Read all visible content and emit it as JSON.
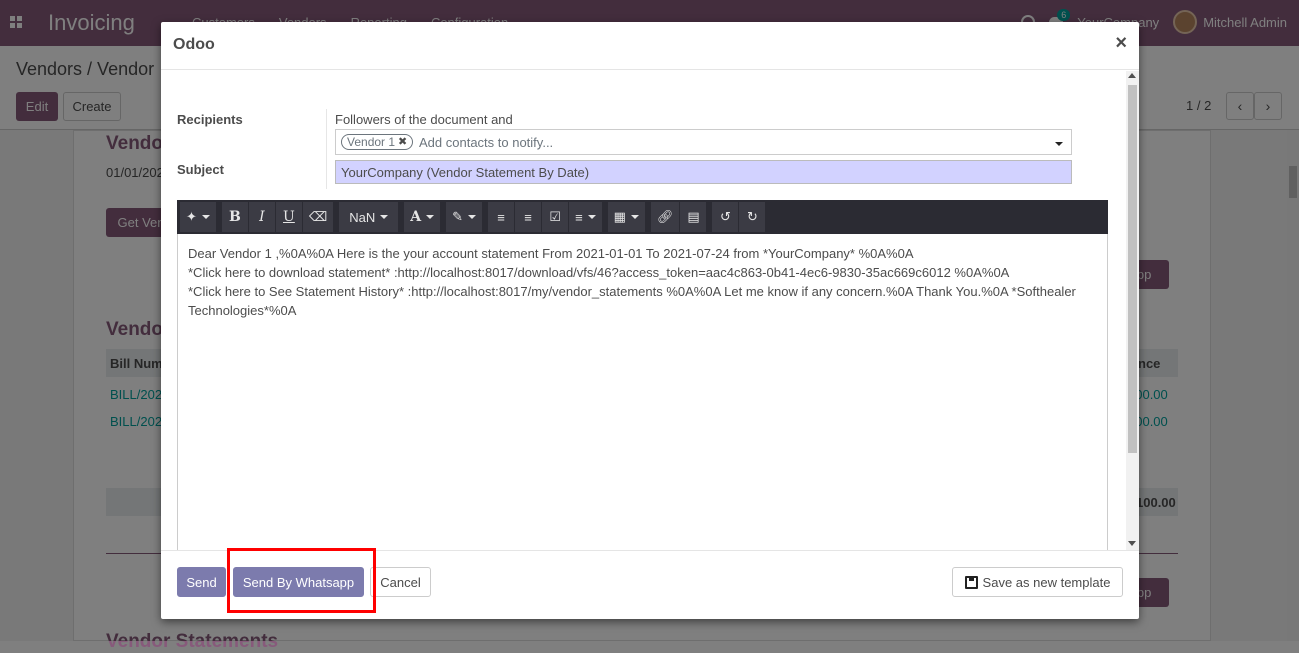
{
  "app": {
    "name": "Invoicing",
    "menu": [
      "Customers",
      "Vendors",
      "Reporting",
      "Configuration"
    ],
    "chat_badge": "6",
    "company": "YourCompany",
    "user": "Mitchell Admin"
  },
  "control_panel": {
    "breadcrumb": "Vendors / Vendor",
    "edit_label": "Edit",
    "create_label": "Create",
    "pager": "1 / 2"
  },
  "background": {
    "heading1": "Vendo",
    "date": "01/01/202",
    "get_btn": "Get Ven",
    "heading2": "Vendo",
    "col_bill": "Bill Num",
    "col_balance": "nce",
    "rows": [
      {
        "bill": "BILL/202",
        "amount": "500.00"
      },
      {
        "bill": "BILL/202",
        "amount": "500.00"
      }
    ],
    "total": "100.00",
    "app_btn": "app",
    "app_btn2": "app",
    "heading3": "Vendor Statements"
  },
  "modal": {
    "title": "Odoo",
    "close": "×",
    "recipients_label": "Recipients",
    "followers_text": "Followers of the document and",
    "recipient_tag": "Vendor 1",
    "recipients_placeholder": "Add contacts to notify...",
    "subject_label": "Subject",
    "subject_value": "YourCompany (Vendor Statement By Date)",
    "toolbar": {
      "font_size": "NaN"
    },
    "body_lines": [
      "Dear Vendor 1 ,%0A%0A Here is the your account statement From 2021-01-01 To 2021-07-24 from *YourCompany* %0A%0A",
      "*Click here to download statement* :http://localhost:8017/download/vfs/46?access_token=aac4c863-0b41-4ec6-9830-35ac669c6012 %0A%0A",
      "*Click here to See Statement History* :http://localhost:8017/my/vendor_statements %0A%0A Let me know if any concern.%0A Thank You.%0A *Softhealer Technologies*%0A"
    ],
    "footer": {
      "send": "Send",
      "send_whatsapp": "Send By Whatsapp",
      "cancel": "Cancel",
      "save_template": "Save as new template"
    }
  },
  "colors": {
    "brand": "#875a7b",
    "primary_button": "#7c7bad",
    "highlight": "#ff0000",
    "subject_bg": "#d2d2ff"
  }
}
